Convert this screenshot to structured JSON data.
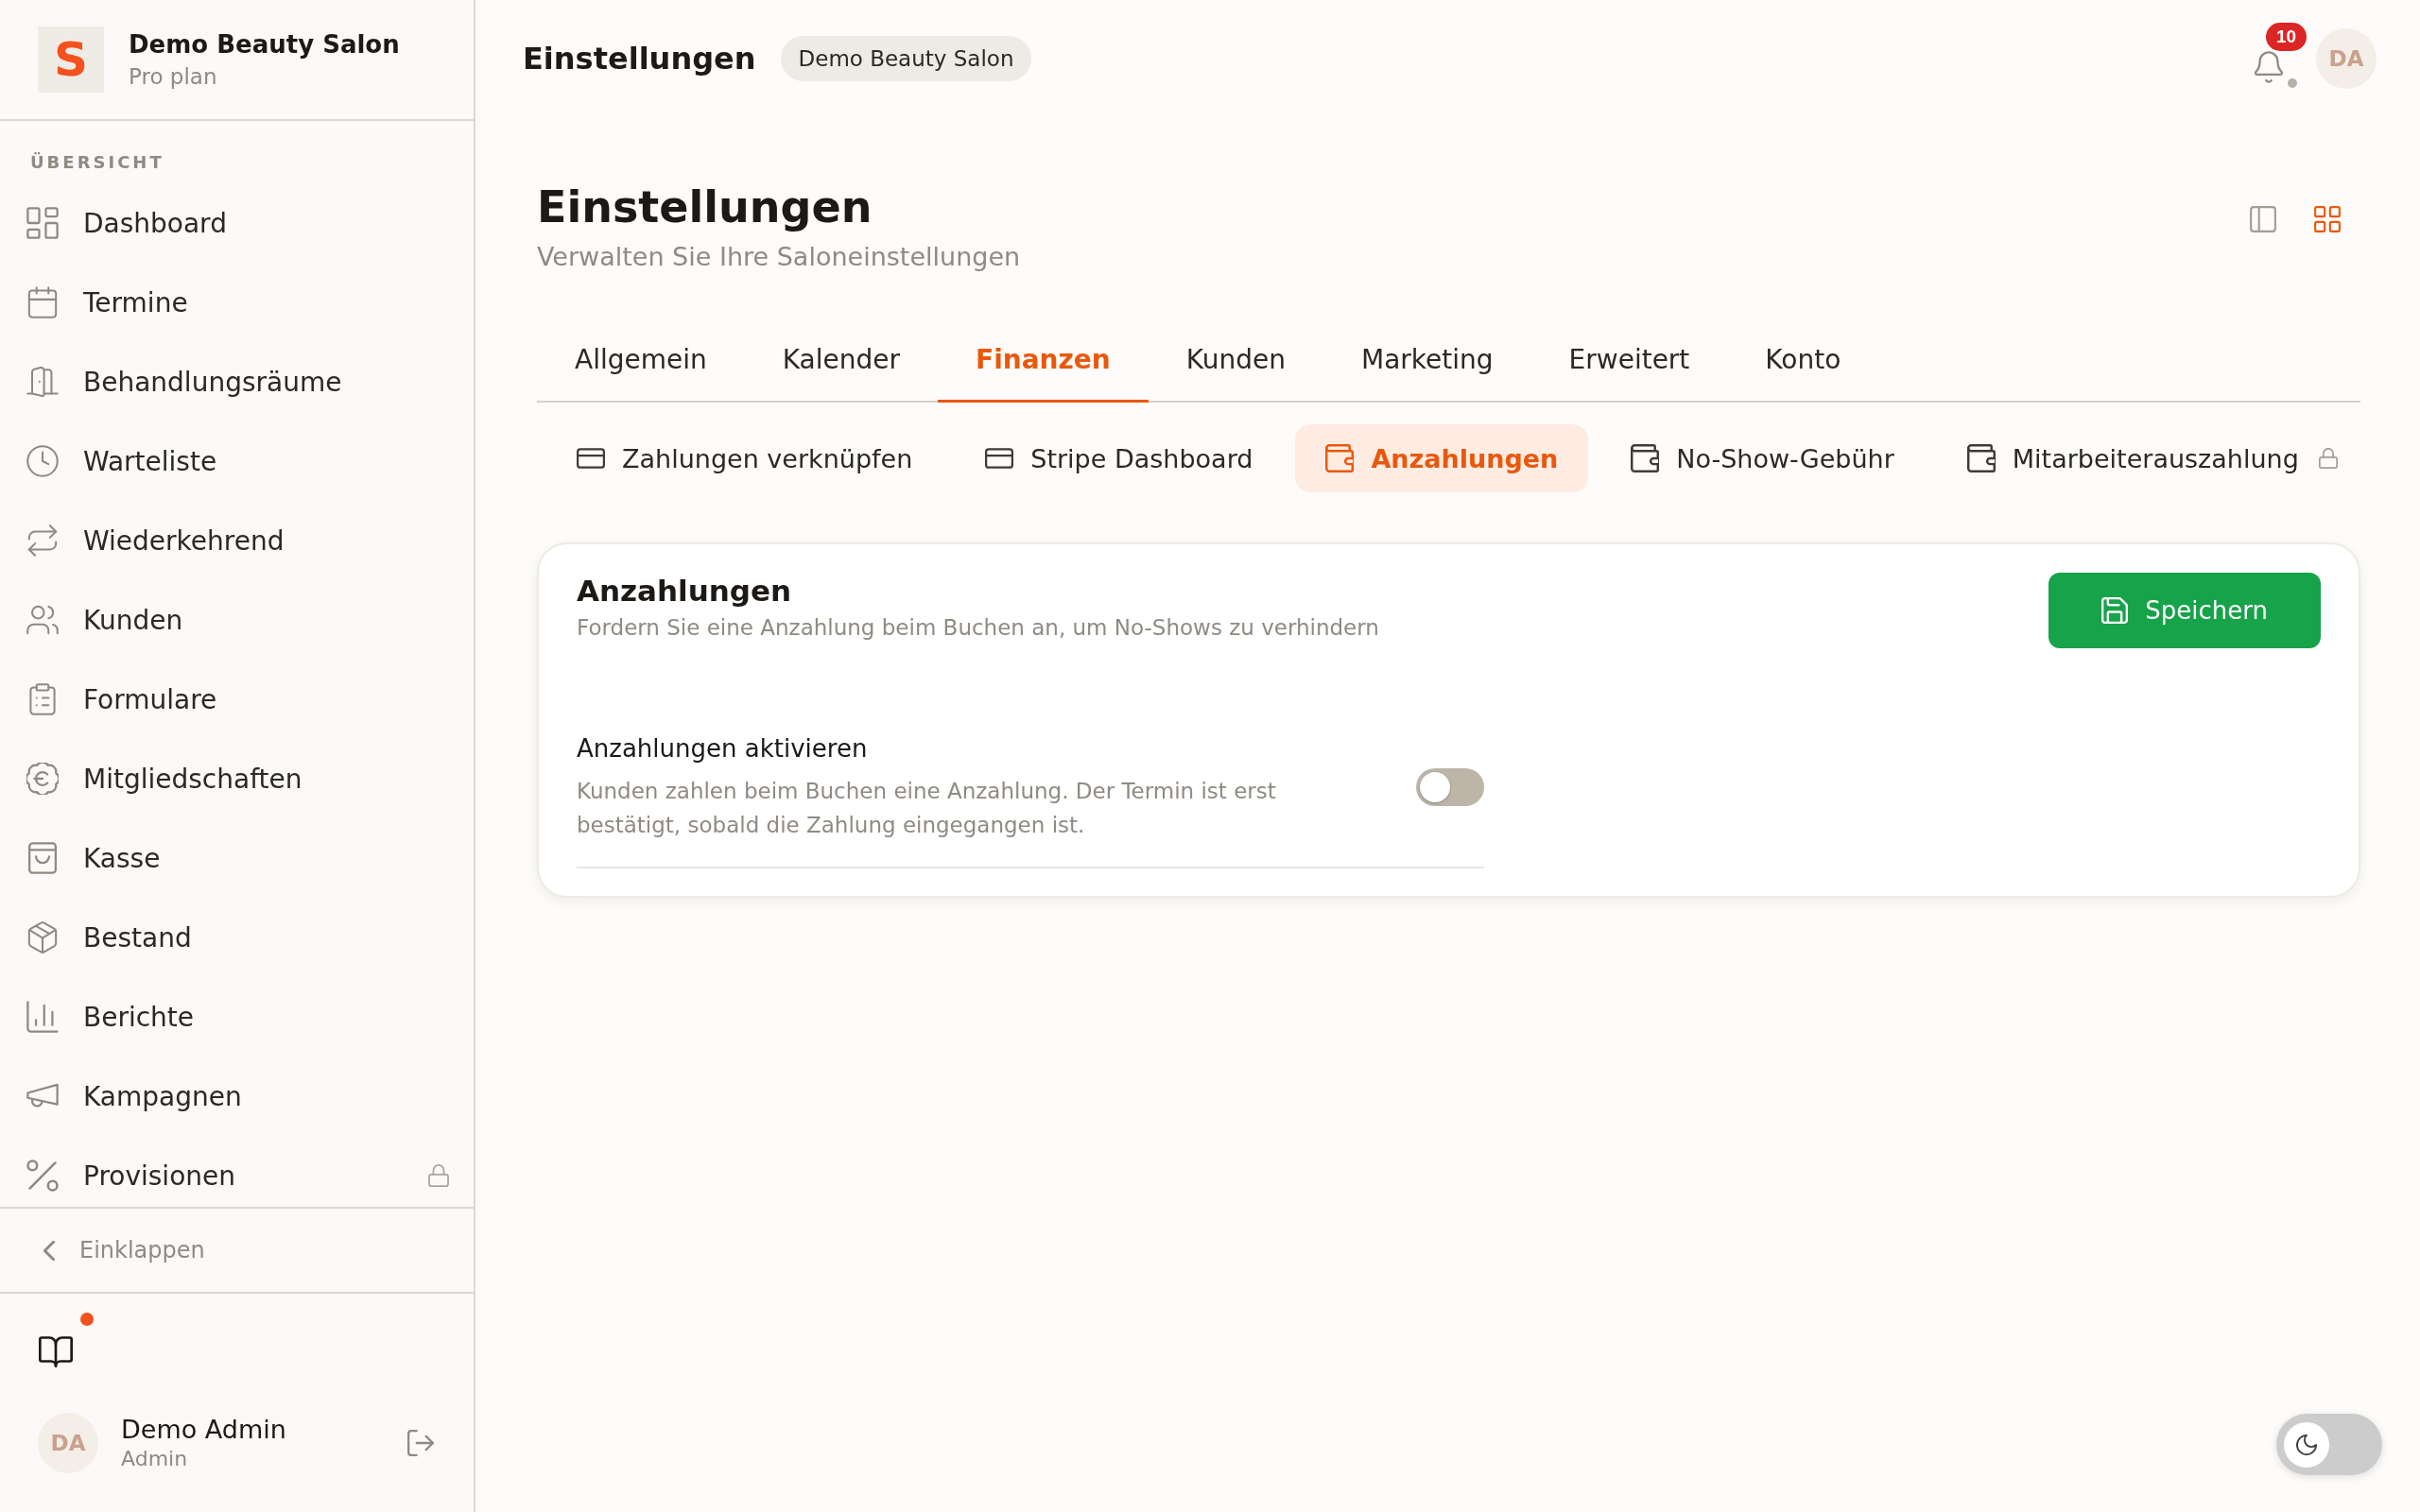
{
  "sidebar": {
    "brand": {
      "logo": "S",
      "name": "Demo Beauty Salon",
      "plan": "Pro plan"
    },
    "section_label": "ÜBERSICHT",
    "items": [
      {
        "label": "Dashboard",
        "selected": false,
        "locked": false
      },
      {
        "label": "Termine",
        "selected": false,
        "locked": false
      },
      {
        "label": "Behandlungsräume",
        "selected": false,
        "locked": false
      },
      {
        "label": "Warteliste",
        "selected": false,
        "locked": false
      },
      {
        "label": "Wiederkehrend",
        "selected": false,
        "locked": false
      },
      {
        "label": "Kunden",
        "selected": false,
        "locked": false
      },
      {
        "label": "Formulare",
        "selected": false,
        "locked": false
      },
      {
        "label": "Mitgliedschaften",
        "selected": false,
        "locked": false
      },
      {
        "label": "Kasse",
        "selected": false,
        "locked": false
      },
      {
        "label": "Bestand",
        "selected": false,
        "locked": false
      },
      {
        "label": "Berichte",
        "selected": false,
        "locked": false
      },
      {
        "label": "Kampagnen",
        "selected": false,
        "locked": false
      },
      {
        "label": "Provisionen",
        "selected": false,
        "locked": true
      }
    ],
    "collapse": {
      "label": "Einklappen"
    },
    "docs_button": {
      "unread": true
    },
    "user": {
      "initials": "DA",
      "name": "Demo Admin",
      "role": "Admin"
    }
  },
  "topbar": {
    "title": "Einstellungen",
    "workspace": "Demo Beauty Salon",
    "notifications": {
      "count": "10",
      "connected": false
    },
    "avatar": {
      "initials": "DA"
    }
  },
  "page": {
    "title": "Einstellungen",
    "subtitle": "Verwalten Sie Ihre Saloneinstellungen",
    "view_options": [
      {
        "selected": false
      },
      {
        "selected": true
      }
    ]
  },
  "tabs": [
    {
      "label": "Allgemein",
      "selected": false
    },
    {
      "label": "Kalender",
      "selected": false
    },
    {
      "label": "Finanzen",
      "selected": true
    },
    {
      "label": "Kunden",
      "selected": false
    },
    {
      "label": "Marketing",
      "selected": false
    },
    {
      "label": "Erweitert",
      "selected": false
    },
    {
      "label": "Konto",
      "selected": false
    }
  ],
  "subtabs": [
    {
      "label": "Zahlungen verknüpfen",
      "selected": false,
      "locked": false
    },
    {
      "label": "Stripe Dashboard",
      "selected": false,
      "locked": false
    },
    {
      "label": "Anzahlungen",
      "selected": true,
      "locked": false
    },
    {
      "label": "No-Show-Gebühr",
      "selected": false,
      "locked": false
    },
    {
      "label": "Mitarbeiterauszahlung",
      "selected": false,
      "locked": true
    }
  ],
  "card": {
    "title": "Anzahlungen",
    "description": "Fordern Sie eine Anzahlung beim Buchen an, um No-Shows zu verhindern",
    "save_button": "Speichern",
    "settings": [
      {
        "label": "Anzahlungen aktivieren",
        "description": "Kunden zahlen beim Buchen eine Anzahlung. Der Termin ist erst bestätigt, sobald die Zahlung eingegangen ist.",
        "on": false
      }
    ]
  },
  "theme_toggle": {
    "dark": false
  }
}
